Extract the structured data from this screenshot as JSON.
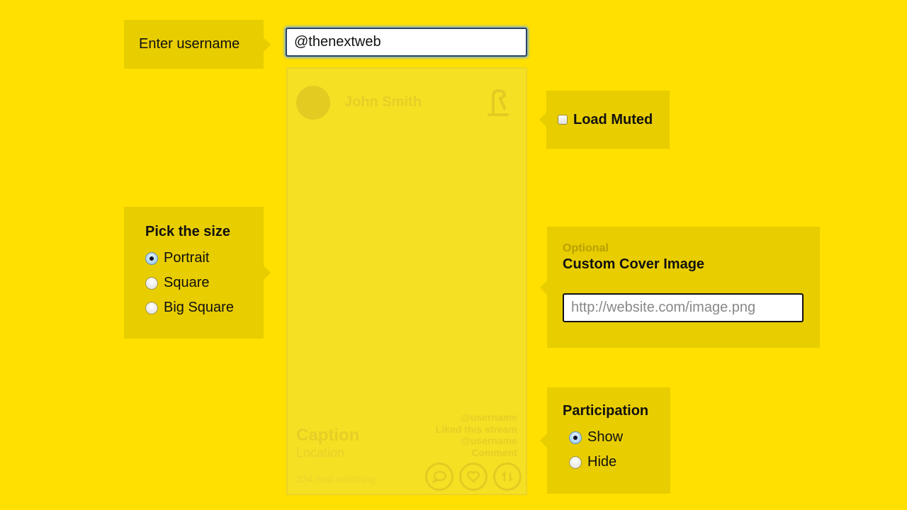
{
  "username": {
    "label": "Enter username",
    "value": "@thenextweb"
  },
  "preview": {
    "name": "John Smith",
    "caption": "Caption",
    "location": "Location",
    "watching": "234 now watching",
    "activity": [
      "@username",
      "Liked this stream",
      "@username",
      "Comment"
    ],
    "icons": [
      "logo-icon",
      "comment-icon",
      "heart-icon",
      "restream-icon"
    ]
  },
  "load_muted": {
    "label": "Load Muted",
    "checked": false
  },
  "size": {
    "title": "Pick the size",
    "options": [
      "Portrait",
      "Square",
      "Big Square"
    ],
    "selected": "Portrait"
  },
  "cover": {
    "optional": "Optional",
    "title": "Custom Cover Image",
    "placeholder": "http://website.com/image.png",
    "value": ""
  },
  "participation": {
    "title": "Participation",
    "options": [
      "Show",
      "Hide"
    ],
    "selected": "Show"
  },
  "colors": {
    "background": "#ffe000",
    "panel": "#e8cd00"
  }
}
